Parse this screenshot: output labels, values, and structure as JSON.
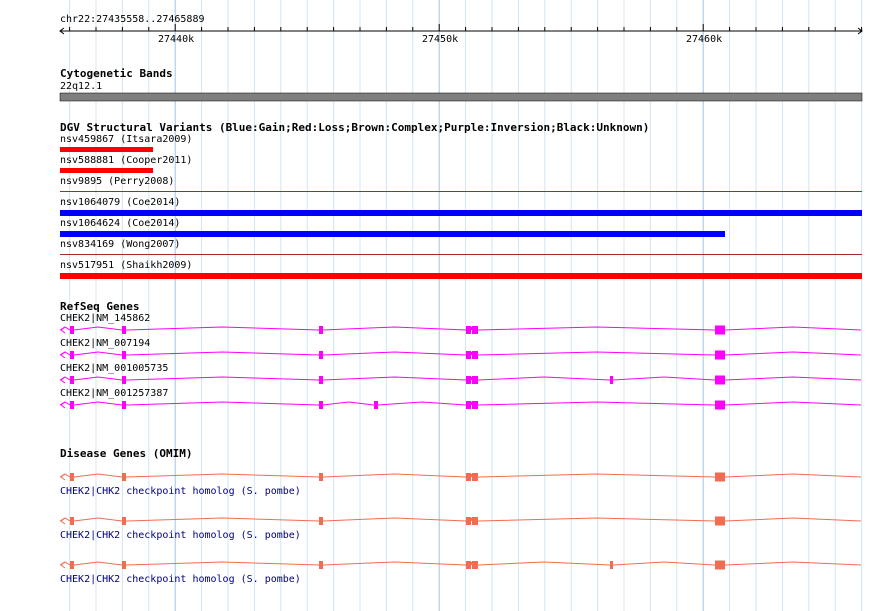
{
  "ruler": {
    "location": "chr22:27435558..27465889",
    "ticks": [
      "27440k",
      "27450k",
      "27460k"
    ]
  },
  "tracks": {
    "cytoband": {
      "title": "Cytogenetic Bands",
      "band_label": "22q12.1",
      "band_color": "#7f7f7f"
    },
    "dgv": {
      "title": "DGV Structural Variants (Blue:Gain;Red:Loss;Brown:Complex;Purple:Inversion;Black:Unknown)",
      "variants": [
        {
          "label": "nsv459867 (Itsara2009)",
          "color": "#ff0000"
        },
        {
          "label": "nsv588881 (Cooper2011)",
          "color": "#ff0000"
        },
        {
          "label": "nsv9895 (Perry2008)",
          "color": "#a52a2a"
        },
        {
          "label": "nsv1064079 (Coe2014)",
          "color": "#0000ff"
        },
        {
          "label": "nsv1064624 (Coe2014)",
          "color": "#0000ff"
        },
        {
          "label": "nsv834169 (Wong2007)",
          "color": "#a52a2a"
        },
        {
          "label": "nsv517951 (Shaikh2009)",
          "color": "#ff0000"
        }
      ]
    },
    "refseq": {
      "title": "RefSeq Genes",
      "color": "#ff00ff",
      "transcripts": [
        {
          "label": "CHEK2|NM_145862"
        },
        {
          "label": "CHEK2|NM_007194"
        },
        {
          "label": "CHEK2|NM_001005735"
        },
        {
          "label": "CHEK2|NM_001257387"
        }
      ]
    },
    "omim": {
      "title": "Disease Genes (OMIM)",
      "color": "#f26c4f",
      "label_color": "#000080",
      "genes": [
        {
          "label": "CHEK2|CHK2 checkpoint homolog (S. pombe)"
        },
        {
          "label": "CHEK2|CHK2 checkpoint homolog (S. pombe)"
        },
        {
          "label": "CHEK2|CHK2 checkpoint homolog (S. pombe)"
        }
      ]
    }
  }
}
